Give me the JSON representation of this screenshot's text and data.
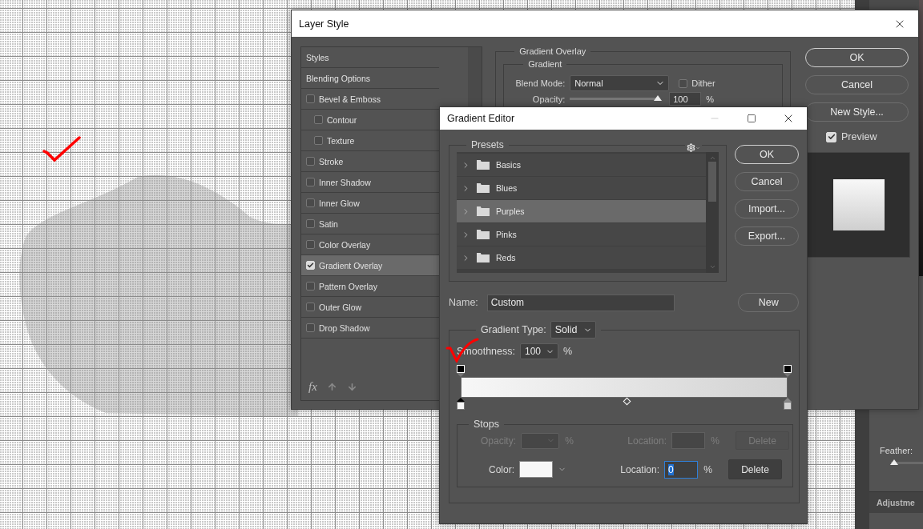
{
  "layer_style": {
    "title": "Layer Style",
    "sidebar": {
      "items": [
        {
          "label": "Styles",
          "kind": "header",
          "selected": false
        },
        {
          "label": "Blending Options",
          "kind": "header",
          "selected": false
        },
        {
          "label": "Bevel & Emboss",
          "kind": "check",
          "checked": false,
          "selected": false,
          "children": [
            {
              "label": "Contour",
              "kind": "check",
              "checked": false,
              "selected": false
            },
            {
              "label": "Texture",
              "kind": "check",
              "checked": false,
              "selected": false
            }
          ]
        },
        {
          "label": "Stroke",
          "kind": "check",
          "checked": false,
          "selected": false
        },
        {
          "label": "Inner Shadow",
          "kind": "check",
          "checked": false,
          "selected": false
        },
        {
          "label": "Inner Glow",
          "kind": "check",
          "checked": false,
          "selected": false
        },
        {
          "label": "Satin",
          "kind": "check",
          "checked": false,
          "selected": false
        },
        {
          "label": "Color Overlay",
          "kind": "check",
          "checked": false,
          "selected": false
        },
        {
          "label": "Gradient Overlay",
          "kind": "check",
          "checked": true,
          "selected": true
        },
        {
          "label": "Pattern Overlay",
          "kind": "check",
          "checked": false,
          "selected": false
        },
        {
          "label": "Outer Glow",
          "kind": "check",
          "checked": false,
          "selected": false
        },
        {
          "label": "Drop Shadow",
          "kind": "check",
          "checked": false,
          "selected": false
        }
      ],
      "footer_label": "fx"
    },
    "gradient_overlay": {
      "title": "Gradient Overlay",
      "group": "Gradient",
      "blend_mode_label": "Blend Mode:",
      "blend_mode": "Normal",
      "dither": {
        "label": "Dither",
        "checked": false
      },
      "opacity_label": "Opacity:",
      "opacity": {
        "level": 1
      },
      "opacity_value": "100",
      "opacity_unit": "%"
    },
    "buttons": [
      {
        "label": "OK",
        "default": true
      },
      {
        "label": "Cancel",
        "default": false
      },
      {
        "label": "New Style...",
        "default": false
      }
    ],
    "preview": {
      "label": "Preview",
      "checked": true
    }
  },
  "gradient_editor": {
    "title": "Gradient Editor",
    "presets_label": "Presets",
    "presets": [
      {
        "label": "Basics",
        "selected": false
      },
      {
        "label": "Blues",
        "selected": false
      },
      {
        "label": "Purples",
        "selected": true
      },
      {
        "label": "Pinks",
        "selected": false
      },
      {
        "label": "Reds",
        "selected": false
      }
    ],
    "buttons": [
      {
        "label": "OK",
        "default": true
      },
      {
        "label": "Cancel",
        "default": false
      },
      {
        "label": "Import...",
        "default": false
      },
      {
        "label": "Export...",
        "default": false
      }
    ],
    "name_label": "Name:",
    "name": "Custom",
    "new_button": "New",
    "gradient_type_label": "Gradient Type:",
    "gradient_type": "Solid",
    "smoothness_label": "Smoothness:",
    "smoothness": "100",
    "smoothness_unit": "%",
    "color_stops": [
      {
        "color": "#f7f7f7",
        "selected": true
      },
      {
        "color": "#d2d2d2",
        "selected": false
      }
    ],
    "stops_label": "Stops",
    "opacity_row": {
      "disabled": true,
      "label": "Opacity:",
      "unit": "%",
      "location_label": "Location:",
      "location_unit": "%",
      "delete": "Delete"
    },
    "color_row": {
      "disabled": false,
      "label": "Color:",
      "location_label": "Location:",
      "location": "0",
      "location_unit": "%",
      "delete": "Delete"
    }
  },
  "side_panel": {
    "feather_label": "Feather:",
    "feather": {
      "level": 0
    },
    "tab": "Adjustme"
  }
}
